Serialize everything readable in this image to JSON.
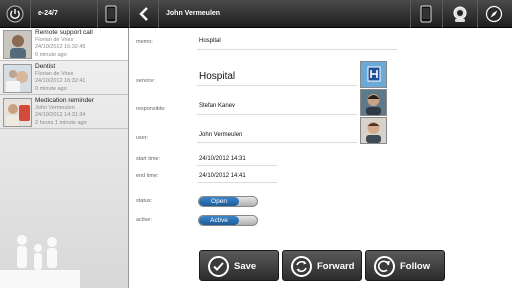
{
  "app": {
    "title": "e-24/7"
  },
  "header": {
    "title": "John Vermeulen"
  },
  "icons": {
    "power": "power-icon",
    "tablet": "tablet-icon",
    "back": "back-chevron-icon",
    "webcam": "webcam-icon",
    "compass": "compass-icon"
  },
  "sidebar": {
    "items": [
      {
        "title": "Remote support call",
        "person": "Florian de Vries",
        "datetime": "24/10/2012 16:32:45",
        "ago": "0 minute ago",
        "thumb": "person-icon"
      },
      {
        "title": "Dentist",
        "person": "Florian de Vries",
        "datetime": "24/10/2012 16:32:41",
        "ago": "0 minute ago",
        "thumb": "dentist-icon"
      },
      {
        "title": "Medication reminder",
        "person": "John Vermeulen",
        "datetime": "24/10/2012 14:31:34",
        "ago": "2 hours 1 minute ago",
        "thumb": "medication-icon"
      }
    ]
  },
  "detail": {
    "memo_label": "memo:",
    "memo_value": "Hospital",
    "service_label": "service:",
    "service_value": "Hospital",
    "responsible_label": "responsible:",
    "responsible_value": "Stefan Kanev",
    "user_label": "user:",
    "user_value": "John Vermeulen",
    "start_label": "start time:",
    "start_value": "24/10/2012 14:31",
    "end_label": "end time:",
    "end_value": "24/10/2012 14:41",
    "status_label": "status:",
    "status_value": "Open",
    "active_label": "active:",
    "active_value": "Active"
  },
  "actions": {
    "save": "Save",
    "forward": "Forward",
    "follow": "Follow"
  },
  "colors": {
    "toggle_on": "#2a6fb0",
    "topbar": "#2b2b2b",
    "button": "#3a3a3a"
  }
}
